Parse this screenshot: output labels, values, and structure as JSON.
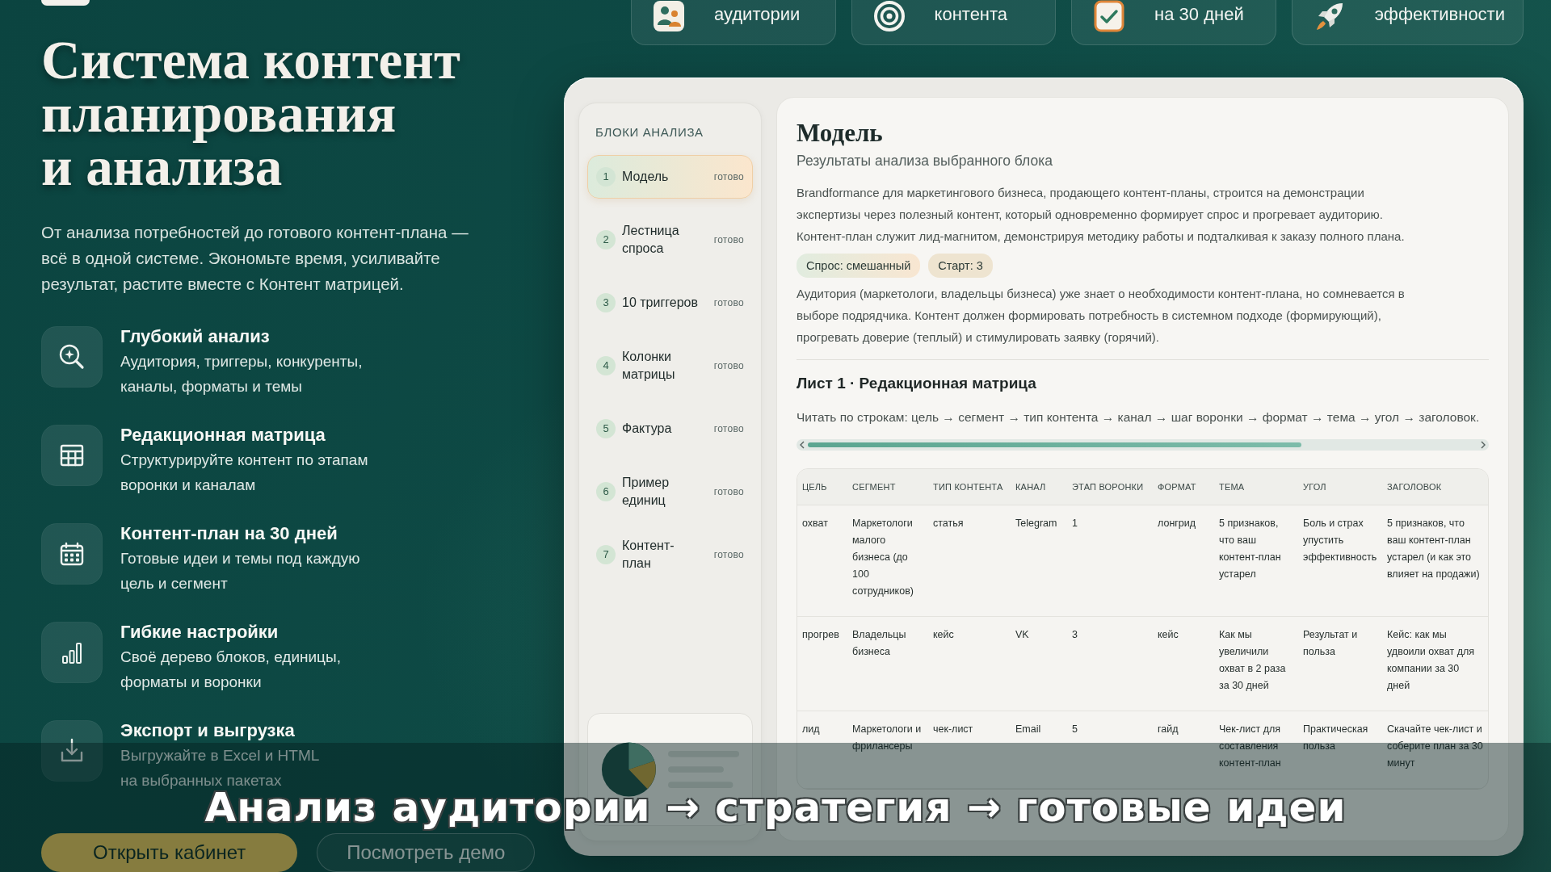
{
  "hero": {
    "title": "Система контент\nпланирования\nи анализа",
    "description": "От анализа потребностей до готового контент-плана —\nвсё в одной системе. Экономьте время, усиливайте\nрезультат, растите вместе с Контент матрицей."
  },
  "features": [
    {
      "kind": "analysis",
      "title": "Глубокий анализ",
      "description": "Аудитория, триггеры, конкуренты,\nканалы, форматы и темы"
    },
    {
      "kind": "matrix",
      "title": "Редакционная матрица",
      "description": "Структурируйте контент по этапам\nворонки и каналам"
    },
    {
      "kind": "plan",
      "title": "Контент-план на 30 дней",
      "description": "Готовые идеи и темы под каждую\nцель и сегмент"
    },
    {
      "kind": "settings",
      "title": "Гибкие настройки",
      "description": "Своё дерево блоков, единицы,\nформаты и воронки"
    },
    {
      "kind": "export",
      "title": "Экспорт и выгрузка",
      "description": "Выгружайте в Excel и HTML\nна выбранных пакетах"
    }
  ],
  "actions": [
    {
      "kind": "primary",
      "label": "Открыть кабинет"
    },
    {
      "kind": "secondary",
      "label": "Посмотреть демо"
    }
  ],
  "top_cards": [
    {
      "kind": "audience",
      "label": "аудитории"
    },
    {
      "kind": "content",
      "label": "контента"
    },
    {
      "kind": "plan",
      "label": "на 30 дней"
    },
    {
      "kind": "efficiency",
      "label": "эффективности"
    }
  ],
  "sidebar": {
    "title": "БЛОКИ АНАЛИЗА",
    "items": [
      {
        "number": "1",
        "label": "Модель",
        "status": "готово",
        "selected": true
      },
      {
        "number": "2",
        "label": "Лестница спроса",
        "status": "готово",
        "selected": false
      },
      {
        "number": "3",
        "label": "10 триггеров",
        "status": "готово",
        "selected": false
      },
      {
        "number": "4",
        "label": "Колонки матрицы",
        "status": "готово",
        "selected": false
      },
      {
        "number": "5",
        "label": "Фактура",
        "status": "готово",
        "selected": false
      },
      {
        "number": "6",
        "label": "Пример единиц",
        "status": "готово",
        "selected": false
      },
      {
        "number": "7",
        "label": "Контент-план",
        "status": "готово",
        "selected": false
      }
    ]
  },
  "panel": {
    "title": "Модель",
    "subtitle": "Результаты анализа выбранного блока",
    "summary": "Brandformance для маркетингового бизнеса, продающего контент-планы, строится на демонстрации\nэкспертизы через полезный контент, который одновременно формирует спрос и прогревает аудиторию.\nКонтент-план служит лид-магнитом, демонстрируя методику работы и подталкивая к заказу полного плана.",
    "tags": [
      {
        "kind": "accent",
        "label": "Спрос: смешанный"
      },
      {
        "kind": "plain",
        "label": "Старт: 3"
      }
    ],
    "note": "Аудитория (маркетологи, владельцы бизнеса) уже знает о необходимости контент-плана, но сомневается в\nвыборе подрядчика. Контент должен формировать потребность в системном подходе (формирующий),\nпрогревать доверие (теплый) и стимулировать заявку (горячий).",
    "sheet_title": "Лист 1 · Редакционная матрица",
    "hint": "Читать по строкам: цель → сегмент → тип контента → канал → шаг воронки → формат → тема → угол → заголовок.",
    "table": {
      "columns": [
        "ЦЕЛЬ",
        "СЕГМЕНТ",
        "ТИП КОНТЕНТА",
        "КАНАЛ",
        "ЭТАП ВОРОНКИ",
        "ФОРМАТ",
        "ТЕМА",
        "УГОЛ",
        "ЗАГОЛОВОК"
      ],
      "rows": [
        [
          "охват",
          "Маркетологи малого бизнеса (до 100 сотрудников)",
          "статья",
          "Telegram",
          "1",
          "лонгрид",
          "5 признаков, что ваш контент-план устарел",
          "Боль и страх упустить эффективность",
          "5 признаков, что ваш контент-план устарел (и как это влияет на продажи)"
        ],
        [
          "прогрев",
          "Владельцы бизнеса",
          "кейс",
          "VK",
          "3",
          "кейс",
          "Как мы увеличили охват в 2 раза за 30 дней",
          "Результат и польза",
          "Кейс: как мы удвоили охват для компании за 30 дней"
        ],
        [
          "лид",
          "Маркетологи и фрилансеры",
          "чек-лист",
          "Email",
          "5",
          "гайд",
          "Чек-лист для составления контент-план",
          "Практическая польза",
          "Скачайте чек-лист и соберите план за 30 минут"
        ]
      ]
    }
  },
  "caption": {
    "text": "Анализ аудитории → стратегия → готовые идеи"
  }
}
